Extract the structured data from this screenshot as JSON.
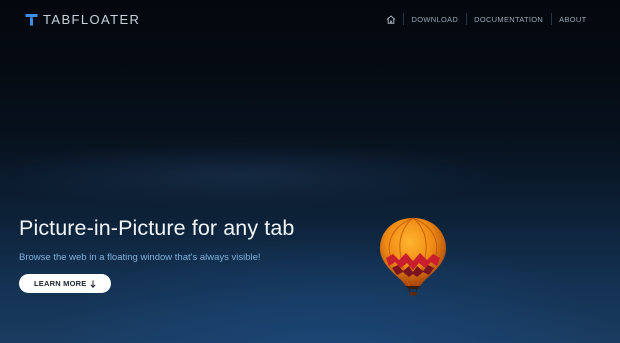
{
  "brand": {
    "name": "TABFLOATER",
    "logo_icon": "tabfloater-logo-icon",
    "accent": "#3f8fe6"
  },
  "nav": {
    "home_icon": "home-icon",
    "items": [
      {
        "label": "DOWNLOAD"
      },
      {
        "label": "DOCUMENTATION"
      },
      {
        "label": "ABOUT"
      }
    ]
  },
  "hero": {
    "title": "Picture-in-Picture for any tab",
    "subtitle": "Browse the web in a floating window that's always visible!",
    "cta_label": "LEARN MORE",
    "cta_icon": "arrow-down-icon"
  },
  "background": {
    "image": "hot-air-balloon-night-sky"
  }
}
